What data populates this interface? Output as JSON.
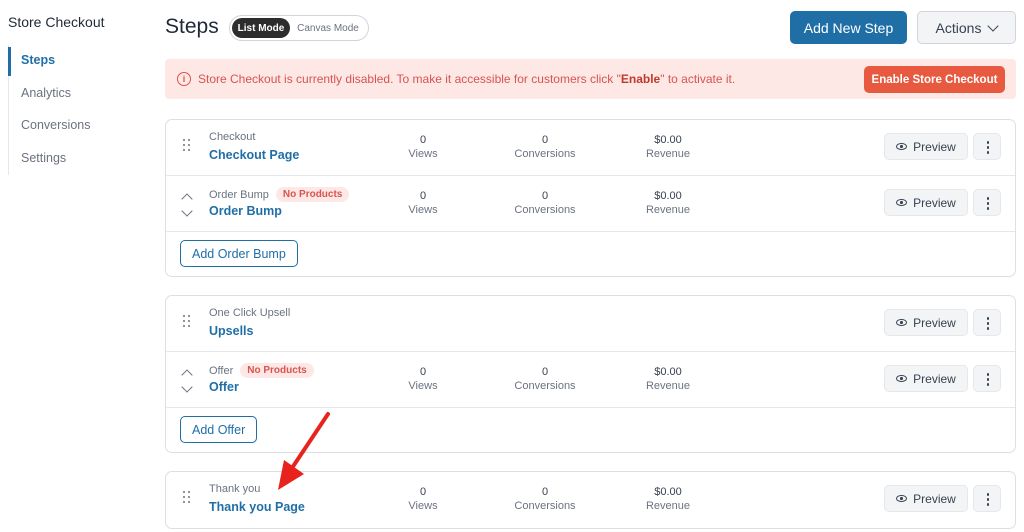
{
  "sidebar": {
    "title": "Store Checkout",
    "items": [
      {
        "label": "Steps",
        "active": true
      },
      {
        "label": "Analytics"
      },
      {
        "label": "Conversions"
      },
      {
        "label": "Settings"
      }
    ]
  },
  "header": {
    "title": "Steps",
    "modes": {
      "list": "List Mode",
      "canvas": "Canvas Mode"
    },
    "add_step_label": "Add New Step",
    "actions_label": "Actions"
  },
  "alert": {
    "text_before": "Store Checkout is currently disabled. To make it accessible for customers click \"",
    "text_bold": "Enable",
    "text_after": "\" to activate it.",
    "button_label": "Enable Store Checkout",
    "color": "#e85a3f"
  },
  "labels": {
    "views": "Views",
    "conversions": "Conversions",
    "revenue": "Revenue",
    "preview": "Preview"
  },
  "groups": [
    {
      "rows": [
        {
          "type": "Checkout",
          "name": "Checkout Page",
          "views": "0",
          "conversions": "0",
          "revenue": "$0.00"
        },
        {
          "type": "Order Bump",
          "badge": "No Products",
          "name": "Order Bump",
          "views": "0",
          "conversions": "0",
          "revenue": "$0.00"
        }
      ],
      "add_label": "Add Order Bump"
    },
    {
      "rows": [
        {
          "type": "One Click Upsell",
          "name": "Upsells"
        },
        {
          "type": "Offer",
          "badge": "No Products",
          "name": "Offer",
          "views": "0",
          "conversions": "0",
          "revenue": "$0.00"
        }
      ],
      "add_label": "Add Offer"
    },
    {
      "rows": [
        {
          "type": "Thank you",
          "name": "Thank you Page",
          "views": "0",
          "conversions": "0",
          "revenue": "$0.00"
        }
      ]
    }
  ],
  "colors": {
    "accent": "#1f6fa6",
    "danger": "#d9534f",
    "annotation": "#e8231e"
  }
}
